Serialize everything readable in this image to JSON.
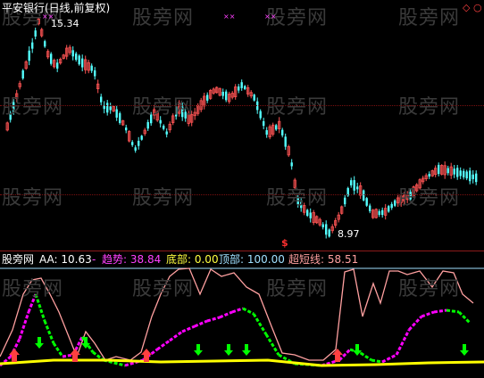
{
  "price_panel": {
    "title": "平安银行(日线,前复权)",
    "high_label": "15.34",
    "low_label": "8.97",
    "signal_marker": "$",
    "top_markers": [
      "××",
      "××",
      "××"
    ]
  },
  "indicator_panel": {
    "source": "股旁网",
    "aa": "AA: 10.63",
    "separator": "-",
    "trend": "趋势: 38.84",
    "bottom": "底部: 0.00",
    "top": "顶部: 100.00",
    "super_short": "超短线: 58.51"
  },
  "watermark": "股旁网",
  "colors": {
    "up": "#ff5454",
    "down": "#54ffff",
    "trend_up": "#ff00ff",
    "trend_down": "#00ff00",
    "super_short": "#ffa0a0",
    "bottom_line": "#ffff00",
    "top_line": "#a0e0ff",
    "label": "#ffffff"
  }
}
